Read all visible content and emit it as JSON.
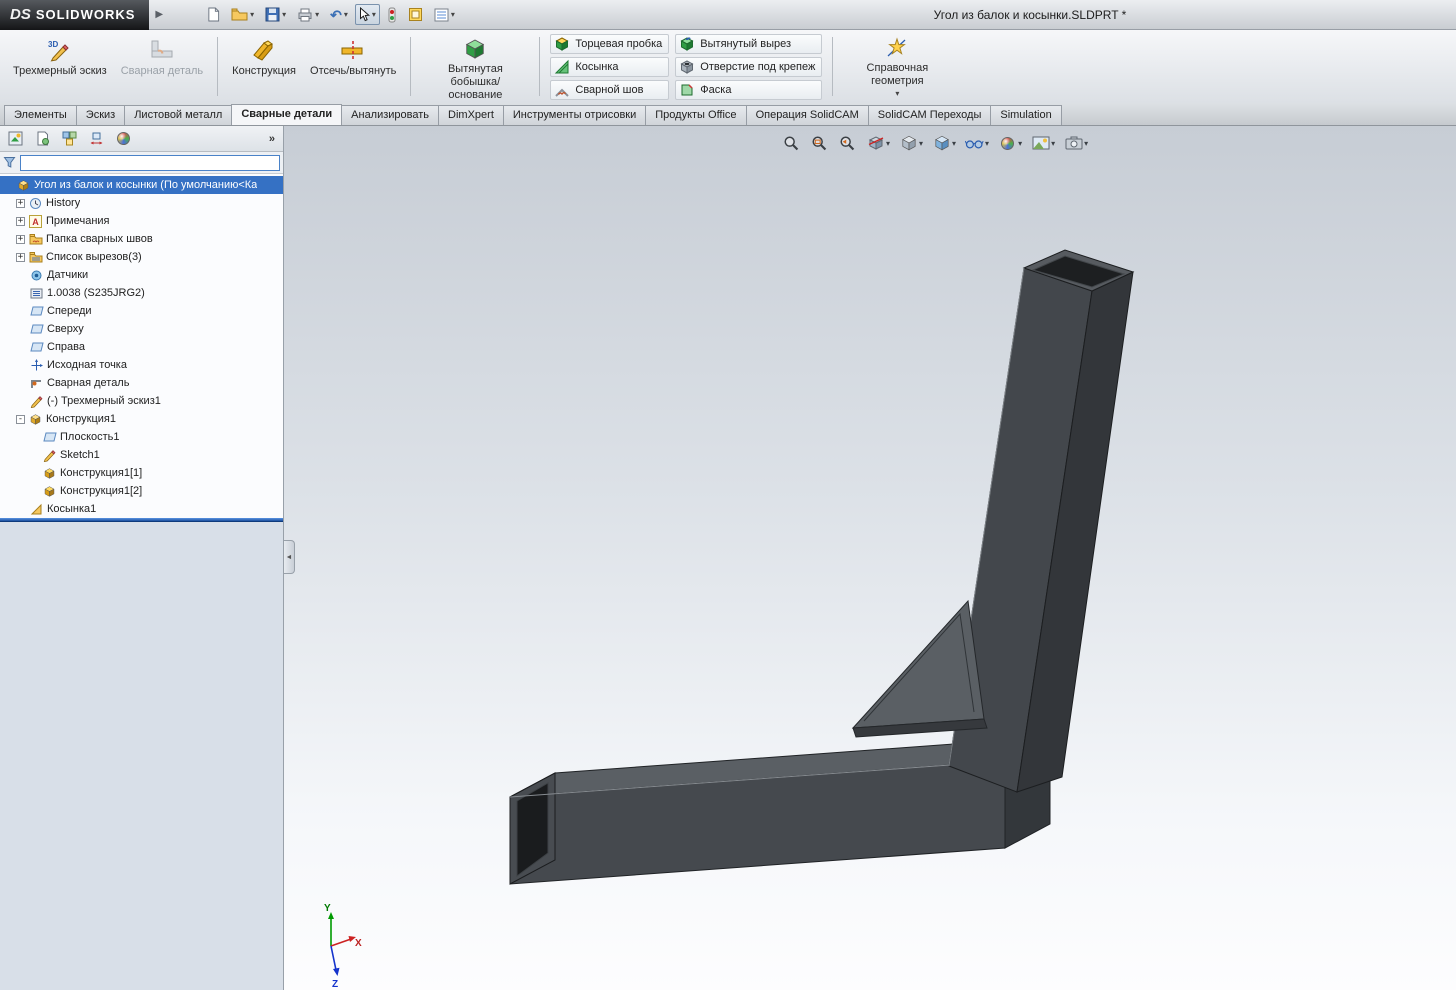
{
  "titlebar": {
    "brand_short": "DS",
    "brand": "SOLIDWORKS",
    "document_title": "Угол из балок и косынки.SLDPRT *",
    "quick_tools": [
      {
        "name": "new-document",
        "icon": "new-document-icon",
        "dropdown": false,
        "pressed": false
      },
      {
        "name": "open",
        "icon": "open-icon",
        "dropdown": true,
        "pressed": false
      },
      {
        "name": "save",
        "icon": "save-icon",
        "dropdown": true,
        "pressed": false
      },
      {
        "name": "print",
        "icon": "print-icon",
        "dropdown": true,
        "pressed": false
      },
      {
        "name": "undo",
        "icon": "undo-icon",
        "dropdown": true,
        "pressed": false
      },
      {
        "name": "select",
        "icon": "select-icon",
        "dropdown": true,
        "pressed": true
      },
      {
        "name": "rebuild",
        "icon": "rebuild-icon",
        "dropdown": false,
        "pressed": false
      },
      {
        "name": "options",
        "icon": "options-icon",
        "dropdown": false,
        "pressed": false
      },
      {
        "name": "task-pane",
        "icon": "task-pane-icon",
        "dropdown": true,
        "pressed": false
      }
    ]
  },
  "ribbon": {
    "groups": [
      {
        "items": [
          {
            "label": "Трехмерный эскиз",
            "icon": "sketch3d-icon",
            "disabled": false,
            "dropdown": false
          },
          {
            "label": "Сварная деталь",
            "icon": "weldment-large-icon",
            "disabled": true,
            "dropdown": false
          }
        ]
      },
      {
        "items": [
          {
            "label": "Конструкция",
            "icon": "structural-member-icon",
            "disabled": false,
            "dropdown": false
          },
          {
            "label": "Отсечь/вытянуть",
            "icon": "trim-extend-icon",
            "disabled": false,
            "dropdown": false
          }
        ]
      },
      {
        "items": [
          {
            "label": "Вытянутая бобышка/основание",
            "icon": "extrude-boss-icon",
            "disabled": false,
            "dropdown": false
          }
        ]
      },
      {
        "small_cols": [
          [
            {
              "label": "Торцевая пробка",
              "icon": "end-cap-icon"
            },
            {
              "label": "Косынка",
              "icon": "gusset-icon"
            },
            {
              "label": "Сварной шов",
              "icon": "weld-bead-icon"
            }
          ],
          [
            {
              "label": "Вытянутый вырез",
              "icon": "extruded-cut-icon"
            },
            {
              "label": "Отверстие под крепеж",
              "icon": "hole-wizard-icon"
            },
            {
              "label": "Фаска",
              "icon": "chamfer-icon"
            }
          ]
        ]
      },
      {
        "items": [
          {
            "label": "Справочная геометрия",
            "icon": "reference-geometry-icon",
            "disabled": false,
            "dropdown": true
          }
        ]
      }
    ]
  },
  "command_tabs": [
    {
      "label": "Элементы",
      "active": false
    },
    {
      "label": "Эскиз",
      "active": false
    },
    {
      "label": "Листовой металл",
      "active": false
    },
    {
      "label": "Сварные детали",
      "active": true
    },
    {
      "label": "Анализировать",
      "active": false
    },
    {
      "label": "DimXpert",
      "active": false
    },
    {
      "label": "Инструменты отрисовки",
      "active": false
    },
    {
      "label": "Продукты Office",
      "active": false
    },
    {
      "label": "Операция SolidCAM",
      "active": false
    },
    {
      "label": "SolidCAM Переходы",
      "active": false
    },
    {
      "label": "Simulation",
      "active": false
    }
  ],
  "feature_panel": {
    "header_icons": [
      "featuremanager-tab-icon",
      "propertymanager-tab-icon",
      "configurationmanager-tab-icon",
      "dimxpertmanager-tab-icon",
      "displaymanager-tab-icon"
    ],
    "overflow_label": "»",
    "filter_value": "",
    "tree": [
      {
        "label": "Угол из балок и косынки  (По умолчанию<Ка",
        "icon": "part-icon",
        "level": 0,
        "selected": true
      },
      {
        "label": "History",
        "icon": "history-folder-icon",
        "expand": "+",
        "level": 1
      },
      {
        "label": "Примечания",
        "icon": "annotations-icon",
        "expand": "+",
        "level": 1
      },
      {
        "label": "Папка сварных швов",
        "icon": "weld-folder-icon",
        "expand": "+",
        "level": 1
      },
      {
        "label": "Список вырезов(3)",
        "icon": "cutlist-folder-icon",
        "expand": "+",
        "level": 1
      },
      {
        "label": "Датчики",
        "icon": "sensors-icon",
        "level": 1
      },
      {
        "label": "1.0038 (S235JRG2)",
        "icon": "material-icon",
        "level": 1
      },
      {
        "label": "Спереди",
        "icon": "plane-icon",
        "level": 1
      },
      {
        "label": "Сверху",
        "icon": "plane-icon",
        "level": 1
      },
      {
        "label": "Справа",
        "icon": "plane-icon",
        "level": 1
      },
      {
        "label": "Исходная точка",
        "icon": "origin-icon",
        "level": 1
      },
      {
        "label": "Сварная деталь",
        "icon": "weldment-icon",
        "level": 1
      },
      {
        "label": "(-) Трехмерный эскиз1",
        "icon": "sketch3d-tree-icon",
        "level": 1
      },
      {
        "label": "Конструкция1",
        "icon": "structure-icon",
        "expand": "-",
        "level": 1
      },
      {
        "label": "Плоскость1",
        "icon": "ref-plane-icon",
        "level": 2
      },
      {
        "label": "Sketch1",
        "icon": "sketch-tree-icon",
        "level": 2
      },
      {
        "label": "Конструкция1[1]",
        "icon": "member-icon",
        "level": 2
      },
      {
        "label": "Конструкция1[2]",
        "icon": "member-icon",
        "level": 2
      },
      {
        "label": "Косынка1",
        "icon": "gusset-tree-icon",
        "level": 1
      }
    ]
  },
  "viewport": {
    "headsup": [
      {
        "name": "zoom-to-fit",
        "icon": "zoom-fit-icon",
        "dropdown": false
      },
      {
        "name": "zoom-to-area",
        "icon": "zoom-area-icon",
        "dropdown": false
      },
      {
        "name": "previous-view",
        "icon": "previous-view-icon",
        "dropdown": false
      },
      {
        "name": "section-view",
        "icon": "section-view-icon",
        "dropdown": true
      },
      {
        "name": "view-orientation",
        "icon": "view-orientation-icon",
        "dropdown": true
      },
      {
        "name": "display-style",
        "icon": "display-style-icon",
        "dropdown": true
      },
      {
        "name": "hide-show-items",
        "icon": "hide-show-icon",
        "dropdown": true
      },
      {
        "name": "edit-appearance",
        "icon": "appearance-icon",
        "dropdown": true
      },
      {
        "name": "apply-scene",
        "icon": "scene-icon",
        "dropdown": true
      },
      {
        "name": "view-settings",
        "icon": "view-settings-icon",
        "dropdown": true
      }
    ],
    "triad": {
      "x_label": "X",
      "y_label": "Y",
      "z_label": "Z"
    }
  }
}
